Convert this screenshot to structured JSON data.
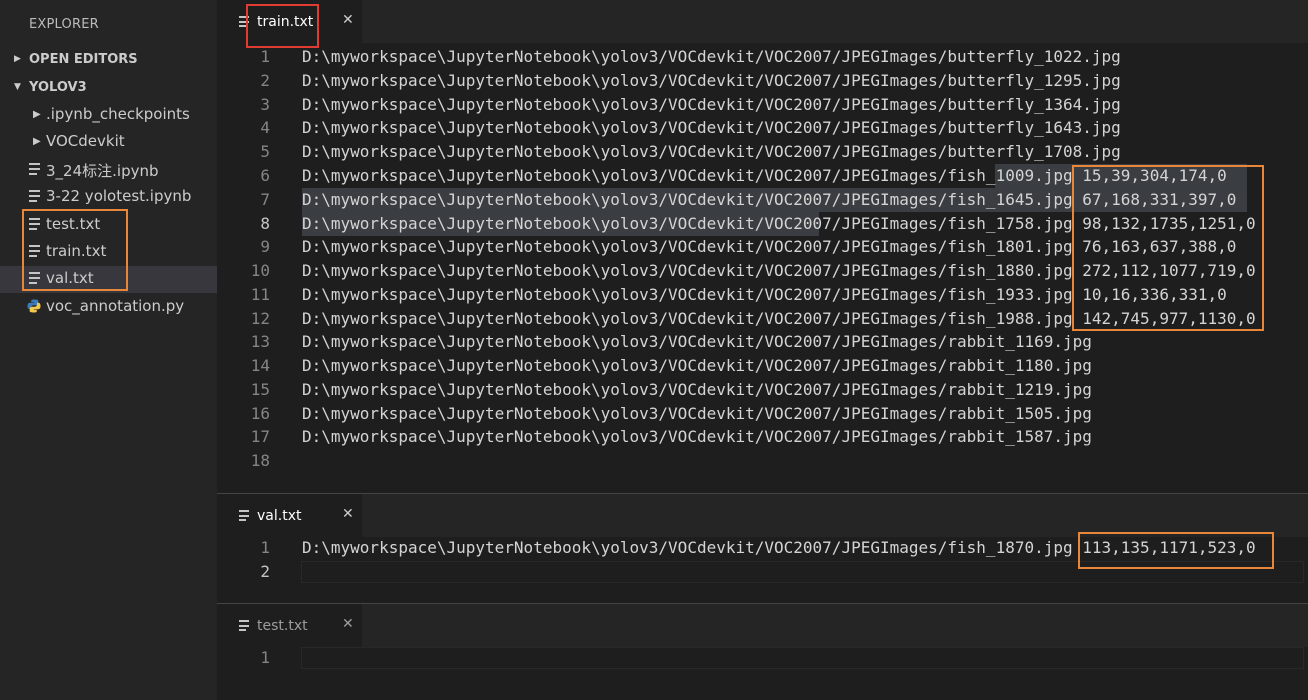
{
  "sidebar": {
    "title": "EXPLORER",
    "sections": [
      {
        "label": "OPEN EDITORS",
        "expanded": false
      },
      {
        "label": "YOLOV3",
        "expanded": true
      }
    ],
    "items": [
      {
        "label": ".ipynb_checkpoints",
        "type": "folder"
      },
      {
        "label": "VOCdevkit",
        "type": "folder"
      },
      {
        "label": "3_24标注.ipynb",
        "type": "file"
      },
      {
        "label": "3-22 yolotest.ipynb",
        "type": "file"
      },
      {
        "label": "test.txt",
        "type": "file"
      },
      {
        "label": "train.txt",
        "type": "file"
      },
      {
        "label": "val.txt",
        "type": "file",
        "selected": true
      },
      {
        "label": "voc_annotation.py",
        "type": "python"
      }
    ]
  },
  "editors": [
    {
      "tab": "train.txt",
      "close_glyph": "✕",
      "lines": [
        {
          "n": "1",
          "text": "D:\\myworkspace\\JupyterNotebook\\yolov3/VOCdevkit/VOC2007/JPEGImages/butterfly_1022.jpg"
        },
        {
          "n": "2",
          "text": "D:\\myworkspace\\JupyterNotebook\\yolov3/VOCdevkit/VOC2007/JPEGImages/butterfly_1295.jpg"
        },
        {
          "n": "3",
          "text": "D:\\myworkspace\\JupyterNotebook\\yolov3/VOCdevkit/VOC2007/JPEGImages/butterfly_1364.jpg"
        },
        {
          "n": "4",
          "text": "D:\\myworkspace\\JupyterNotebook\\yolov3/VOCdevkit/VOC2007/JPEGImages/butterfly_1643.jpg"
        },
        {
          "n": "5",
          "text": "D:\\myworkspace\\JupyterNotebook\\yolov3/VOCdevkit/VOC2007/JPEGImages/butterfly_1708.jpg"
        },
        {
          "n": "6",
          "text": "D:\\myworkspace\\JupyterNotebook\\yolov3/VOCdevkit/VOC2007/JPEGImages/fish_1009.jpg 15,39,304,174,0"
        },
        {
          "n": "7",
          "text": "D:\\myworkspace\\JupyterNotebook\\yolov3/VOCdevkit/VOC2007/JPEGImages/fish_1645.jpg 67,168,331,397,0"
        },
        {
          "n": "8",
          "text": "D:\\myworkspace\\JupyterNotebook\\yolov3/VOCdevkit/VOC2007/JPEGImages/fish_1758.jpg 98,132,1735,1251,0"
        },
        {
          "n": "9",
          "text": "D:\\myworkspace\\JupyterNotebook\\yolov3/VOCdevkit/VOC2007/JPEGImages/fish_1801.jpg 76,163,637,388,0"
        },
        {
          "n": "10",
          "text": "D:\\myworkspace\\JupyterNotebook\\yolov3/VOCdevkit/VOC2007/JPEGImages/fish_1880.jpg 272,112,1077,719,0"
        },
        {
          "n": "11",
          "text": "D:\\myworkspace\\JupyterNotebook\\yolov3/VOCdevkit/VOC2007/JPEGImages/fish_1933.jpg 10,16,336,331,0"
        },
        {
          "n": "12",
          "text": "D:\\myworkspace\\JupyterNotebook\\yolov3/VOCdevkit/VOC2007/JPEGImages/fish_1988.jpg 142,745,977,1130,0"
        },
        {
          "n": "13",
          "text": "D:\\myworkspace\\JupyterNotebook\\yolov3/VOCdevkit/VOC2007/JPEGImages/rabbit_1169.jpg"
        },
        {
          "n": "14",
          "text": "D:\\myworkspace\\JupyterNotebook\\yolov3/VOCdevkit/VOC2007/JPEGImages/rabbit_1180.jpg"
        },
        {
          "n": "15",
          "text": "D:\\myworkspace\\JupyterNotebook\\yolov3/VOCdevkit/VOC2007/JPEGImages/rabbit_1219.jpg"
        },
        {
          "n": "16",
          "text": "D:\\myworkspace\\JupyterNotebook\\yolov3/VOCdevkit/VOC2007/JPEGImages/rabbit_1505.jpg"
        },
        {
          "n": "17",
          "text": "D:\\myworkspace\\JupyterNotebook\\yolov3/VOCdevkit/VOC2007/JPEGImages/rabbit_1587.jpg"
        },
        {
          "n": "18",
          "text": ""
        }
      ]
    },
    {
      "tab": "val.txt",
      "close_glyph": "✕",
      "lines": [
        {
          "n": "1",
          "text": "D:\\myworkspace\\JupyterNotebook\\yolov3/VOCdevkit/VOC2007/JPEGImages/fish_1870.jpg 113,135,1171,523,0"
        },
        {
          "n": "2",
          "text": ""
        }
      ]
    },
    {
      "tab": "test.txt",
      "close_glyph": "✕",
      "lines": [
        {
          "n": "1",
          "text": ""
        }
      ]
    }
  ],
  "colors": {
    "annotation_orange": "#e8863a",
    "annotation_red": "#e03c31",
    "selection": "#3a3d41"
  }
}
